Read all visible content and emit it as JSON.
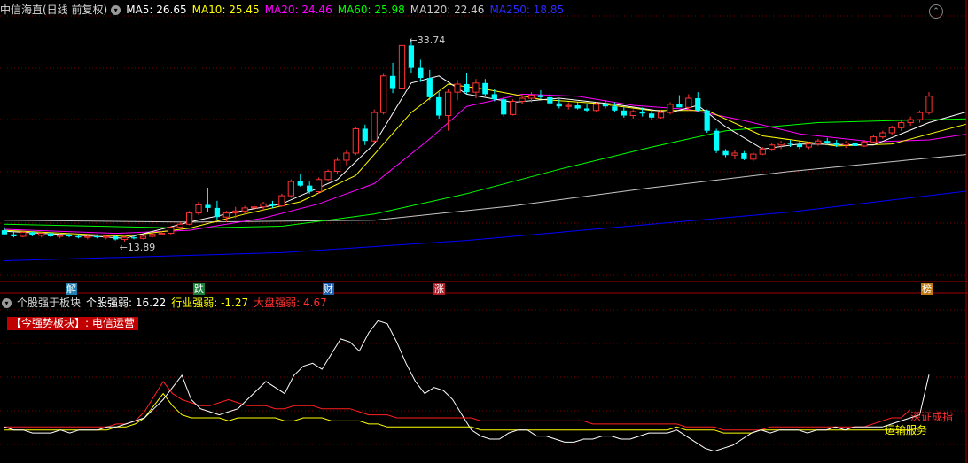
{
  "header": {
    "stock_title": "中信海直(日线 前复权)",
    "ma5": "MA5: 26.65",
    "ma10": "MA10: 25.45",
    "ma20": "MA20: 24.46",
    "ma60": "MA60: 25.98",
    "ma120": "MA120: 22.46",
    "ma250": "MA250: 18.85"
  },
  "sub_header": {
    "title": "个股强于板块",
    "stock_strength": "个股强弱: 16.22",
    "industry_strength": "行业强弱: -1.27",
    "market_strength": "大盘强弱: 4.67"
  },
  "sector_tag": "【今强势板块】: 电信运营",
  "right_labels": {
    "shenzhen": "深证成指",
    "transport": "运输服务"
  },
  "badges": [
    {
      "text": "解",
      "color": "#1e7fb0",
      "fg": "#fff"
    },
    {
      "text": "跌",
      "color": "#1b7f3a",
      "fg": "#fff"
    },
    {
      "text": "财",
      "color": "#1f5fb0",
      "fg": "#fff"
    },
    {
      "text": "涨",
      "color": "#b01e2a",
      "fg": "#fff"
    },
    {
      "text": "榜",
      "color": "#c07a10",
      "fg": "#fff"
    }
  ],
  "colors": {
    "ma5": "#ffffff",
    "ma10": "#ffff00",
    "ma20": "#ff00ff",
    "ma60": "#00ff00",
    "ma120": "#c8c8c8",
    "ma250": "#0000ff",
    "up": "#ff3232",
    "down": "#00ffff",
    "grid": "#7a0000"
  },
  "chart_data": [
    {
      "type": "candlestick",
      "title": "中信海直(日线 前复权)",
      "annotations": [
        {
          "text": "33.74",
          "note": "high"
        },
        {
          "text": "13.89",
          "note": "low"
        }
      ],
      "candles": [
        [
          15.0,
          15.3,
          14.6,
          14.6
        ],
        [
          14.6,
          14.8,
          14.3,
          14.4
        ],
        [
          14.4,
          14.9,
          14.3,
          14.8
        ],
        [
          14.8,
          14.9,
          14.4,
          14.5
        ],
        [
          14.5,
          14.8,
          14.3,
          14.7
        ],
        [
          14.7,
          14.8,
          14.3,
          14.4
        ],
        [
          14.4,
          14.6,
          14.2,
          14.5
        ],
        [
          14.5,
          14.7,
          14.3,
          14.4
        ],
        [
          14.4,
          14.6,
          14.2,
          14.3
        ],
        [
          14.3,
          14.5,
          14.1,
          14.4
        ],
        [
          14.4,
          14.6,
          14.2,
          14.3
        ],
        [
          14.3,
          14.5,
          14.1,
          14.4
        ],
        [
          14.4,
          14.5,
          14.0,
          14.1
        ],
        [
          14.1,
          14.4,
          13.89,
          14.3
        ],
        [
          14.3,
          14.5,
          14.1,
          14.2
        ],
        [
          14.2,
          14.5,
          14.1,
          14.4
        ],
        [
          14.4,
          14.7,
          14.3,
          14.6
        ],
        [
          14.6,
          14.9,
          14.5,
          14.7
        ],
        [
          14.7,
          15.4,
          14.6,
          15.3
        ],
        [
          15.3,
          15.8,
          15.1,
          15.6
        ],
        [
          15.6,
          16.9,
          15.5,
          16.7
        ],
        [
          16.7,
          17.8,
          16.5,
          17.5
        ],
        [
          17.5,
          19.2,
          16.8,
          17.2
        ],
        [
          17.2,
          17.9,
          16.0,
          16.3
        ],
        [
          16.3,
          16.9,
          15.8,
          16.7
        ],
        [
          16.7,
          17.3,
          16.2,
          16.9
        ],
        [
          16.9,
          17.4,
          16.6,
          17.2
        ],
        [
          17.2,
          17.6,
          16.9,
          17.3
        ],
        [
          17.3,
          17.8,
          17.0,
          17.6
        ],
        [
          17.6,
          17.9,
          17.2,
          17.4
        ],
        [
          17.4,
          18.6,
          17.3,
          18.4
        ],
        [
          18.4,
          20.0,
          18.2,
          19.8
        ],
        [
          19.8,
          20.6,
          19.3,
          19.4
        ],
        [
          19.4,
          19.8,
          18.6,
          18.8
        ],
        [
          18.8,
          20.2,
          18.6,
          20.0
        ],
        [
          20.0,
          21.0,
          19.8,
          20.8
        ],
        [
          20.8,
          22.2,
          20.6,
          21.9
        ],
        [
          21.9,
          22.9,
          21.4,
          22.6
        ],
        [
          22.6,
          25.2,
          22.4,
          25.0
        ],
        [
          25.0,
          25.4,
          23.4,
          23.8
        ],
        [
          23.8,
          26.9,
          23.6,
          26.6
        ],
        [
          26.6,
          30.4,
          26.4,
          30.2
        ],
        [
          30.2,
          31.5,
          28.5,
          29.0
        ],
        [
          29.0,
          33.74,
          28.6,
          33.2
        ],
        [
          33.2,
          33.74,
          30.5,
          31.0
        ],
        [
          31.0,
          31.8,
          29.6,
          30.0
        ],
        [
          30.0,
          30.8,
          27.8,
          28.1
        ],
        [
          28.1,
          28.6,
          26.0,
          26.3
        ],
        [
          26.3,
          28.9,
          24.8,
          28.6
        ],
        [
          28.6,
          29.8,
          27.8,
          29.4
        ],
        [
          29.4,
          30.5,
          28.4,
          28.6
        ],
        [
          28.6,
          29.9,
          28.0,
          29.5
        ],
        [
          29.5,
          29.9,
          28.2,
          28.4
        ],
        [
          28.4,
          28.9,
          27.7,
          27.9
        ],
        [
          27.9,
          28.1,
          26.2,
          26.4
        ],
        [
          26.4,
          27.9,
          26.3,
          27.7
        ],
        [
          27.7,
          28.4,
          27.4,
          28.0
        ],
        [
          28.0,
          28.6,
          27.6,
          28.3
        ],
        [
          28.3,
          28.8,
          27.9,
          28.1
        ],
        [
          28.1,
          28.5,
          27.3,
          27.5
        ],
        [
          27.5,
          27.9,
          27.0,
          27.2
        ],
        [
          27.2,
          27.6,
          26.9,
          27.3
        ],
        [
          27.3,
          27.6,
          26.9,
          27.0
        ],
        [
          27.0,
          27.4,
          26.6,
          26.8
        ],
        [
          26.8,
          27.6,
          26.7,
          27.4
        ],
        [
          27.4,
          27.8,
          27.0,
          27.2
        ],
        [
          27.2,
          27.6,
          26.6,
          26.8
        ],
        [
          26.8,
          27.1,
          26.1,
          26.3
        ],
        [
          26.3,
          26.9,
          26.0,
          26.7
        ],
        [
          26.7,
          27.1,
          26.2,
          26.5
        ],
        [
          26.5,
          26.9,
          25.9,
          26.1
        ],
        [
          26.1,
          26.8,
          26.0,
          26.6
        ],
        [
          26.6,
          27.6,
          26.4,
          27.4
        ],
        [
          27.4,
          28.3,
          27.1,
          27.1
        ],
        [
          27.1,
          28.4,
          26.8,
          28.0
        ],
        [
          28.0,
          28.6,
          26.7,
          26.8
        ],
        [
          26.8,
          26.9,
          24.6,
          24.8
        ],
        [
          24.8,
          25.0,
          22.6,
          22.8
        ],
        [
          22.8,
          23.0,
          22.2,
          22.4
        ],
        [
          22.4,
          22.9,
          22.0,
          22.6
        ],
        [
          22.6,
          22.8,
          21.9,
          22.0
        ],
        [
          22.0,
          22.7,
          21.8,
          22.5
        ],
        [
          22.5,
          23.2,
          22.4,
          23.0
        ],
        [
          23.0,
          23.6,
          22.8,
          23.4
        ],
        [
          23.4,
          23.8,
          23.0,
          23.6
        ],
        [
          23.6,
          23.9,
          23.2,
          23.5
        ],
        [
          23.5,
          23.8,
          23.0,
          23.2
        ],
        [
          23.2,
          23.7,
          23.0,
          23.5
        ],
        [
          23.5,
          24.0,
          23.3,
          23.8
        ],
        [
          23.8,
          24.1,
          23.4,
          23.6
        ],
        [
          23.6,
          23.9,
          23.2,
          23.4
        ],
        [
          23.4,
          23.8,
          23.1,
          23.6
        ],
        [
          23.6,
          23.9,
          23.2,
          23.3
        ],
        [
          23.3,
          23.9,
          23.2,
          23.7
        ],
        [
          23.7,
          24.4,
          23.6,
          24.2
        ],
        [
          24.2,
          24.8,
          24.0,
          24.6
        ],
        [
          24.6,
          25.3,
          24.4,
          25.1
        ],
        [
          25.1,
          25.8,
          24.8,
          25.6
        ],
        [
          25.6,
          26.2,
          25.3,
          25.9
        ],
        [
          25.9,
          26.8,
          25.6,
          26.6
        ],
        [
          26.6,
          28.6,
          26.4,
          28.2
        ]
      ],
      "ma": {
        "ma5": [
          [
            0,
            14.9
          ],
          [
            10,
            14.4
          ],
          [
            13,
            14.2
          ],
          [
            20,
            15.8
          ],
          [
            25,
            16.8
          ],
          [
            30,
            17.6
          ],
          [
            36,
            20.0
          ],
          [
            40,
            23.5
          ],
          [
            44,
            29.5
          ],
          [
            47,
            30.2
          ],
          [
            50,
            28.4
          ],
          [
            55,
            27.6
          ],
          [
            60,
            28.0
          ],
          [
            66,
            27.4
          ],
          [
            72,
            26.6
          ],
          [
            75,
            27.3
          ],
          [
            78,
            25.2
          ],
          [
            82,
            23.0
          ],
          [
            86,
            23.5
          ],
          [
            94,
            23.4
          ],
          [
            100,
            25.6
          ],
          [
            104,
            26.65
          ]
        ],
        "ma10": [
          [
            0,
            15.0
          ],
          [
            13,
            14.4
          ],
          [
            20,
            15.2
          ],
          [
            26,
            16.6
          ],
          [
            32,
            17.8
          ],
          [
            38,
            20.4
          ],
          [
            44,
            26.6
          ],
          [
            48,
            29.4
          ],
          [
            52,
            28.9
          ],
          [
            58,
            27.9
          ],
          [
            64,
            27.5
          ],
          [
            70,
            26.8
          ],
          [
            76,
            26.8
          ],
          [
            82,
            24.3
          ],
          [
            90,
            23.3
          ],
          [
            96,
            23.5
          ],
          [
            104,
            25.45
          ]
        ],
        "ma20": [
          [
            0,
            15.1
          ],
          [
            12,
            14.7
          ],
          [
            20,
            15.0
          ],
          [
            28,
            16.2
          ],
          [
            34,
            17.6
          ],
          [
            40,
            19.6
          ],
          [
            46,
            24.0
          ],
          [
            50,
            27.2
          ],
          [
            56,
            28.4
          ],
          [
            62,
            28.2
          ],
          [
            68,
            27.3
          ],
          [
            74,
            26.9
          ],
          [
            80,
            25.8
          ],
          [
            86,
            24.5
          ],
          [
            94,
            23.7
          ],
          [
            100,
            23.9
          ],
          [
            104,
            24.46
          ]
        ],
        "ma60": [
          [
            0,
            15.6
          ],
          [
            20,
            15.2
          ],
          [
            30,
            15.4
          ],
          [
            40,
            16.6
          ],
          [
            50,
            18.6
          ],
          [
            60,
            21.0
          ],
          [
            70,
            23.2
          ],
          [
            78,
            24.8
          ],
          [
            88,
            25.6
          ],
          [
            96,
            25.8
          ],
          [
            104,
            25.98
          ]
        ],
        "ma120": [
          [
            0,
            16.0
          ],
          [
            20,
            15.8
          ],
          [
            40,
            16.0
          ],
          [
            55,
            17.4
          ],
          [
            70,
            19.2
          ],
          [
            85,
            20.8
          ],
          [
            104,
            22.46
          ]
        ],
        "ma250": [
          [
            0,
            12.0
          ],
          [
            30,
            12.8
          ],
          [
            50,
            14.0
          ],
          [
            70,
            15.6
          ],
          [
            85,
            16.8
          ],
          [
            104,
            18.85
          ]
        ]
      }
    },
    {
      "type": "line",
      "title": "个股强于板块",
      "series": [
        {
          "name": "个股强弱",
          "color": "#ffffff",
          "values": [
            -1,
            -2,
            -2,
            -3,
            -3,
            -3,
            -2,
            -3,
            -2,
            -2,
            -2,
            -1,
            -1,
            0,
            1,
            2,
            5,
            8,
            12,
            16,
            8,
            5,
            4,
            3,
            4,
            5,
            8,
            11,
            14,
            12,
            10,
            16,
            19,
            20,
            18,
            23,
            28,
            27,
            24,
            30,
            34,
            33,
            27,
            20,
            14,
            10,
            12,
            11,
            8,
            3,
            -2,
            -4,
            -5,
            -5,
            -3,
            -2,
            -2,
            -4,
            -4,
            -5,
            -6,
            -6,
            -5,
            -5,
            -4,
            -4,
            -5,
            -5,
            -4,
            -3,
            -3,
            -3,
            -2,
            -4,
            -6,
            -8,
            -9,
            -8,
            -7,
            -5,
            -3,
            -2,
            -3,
            -2,
            -2,
            -2,
            -3,
            -2,
            -2,
            -1,
            -2,
            -1,
            -1,
            -1,
            -1,
            0,
            1,
            2,
            3,
            16.22
          ]
        },
        {
          "name": "行业强弱",
          "color": "#ffff00",
          "values": [
            -2,
            -2,
            -2,
            -2,
            -2,
            -2,
            -2,
            -2,
            -2,
            -2,
            -2,
            -2,
            -1,
            -1,
            0,
            2,
            6,
            10,
            6,
            3,
            2,
            2,
            2,
            2,
            1,
            2,
            2,
            2,
            2,
            2,
            1,
            1,
            2,
            2,
            2,
            1,
            1,
            1,
            1,
            0,
            0,
            -1,
            -1,
            -1,
            -1,
            -1,
            -1,
            -1,
            -1,
            -1,
            -1,
            -2,
            -2,
            -2,
            -2,
            -2,
            -2,
            -2,
            -2,
            -2,
            -2,
            -2,
            -2,
            -2,
            -2,
            -2,
            -2,
            -2,
            -2,
            -2,
            -2,
            -2,
            -1,
            -2,
            -2,
            -2,
            -2,
            -3,
            -3,
            -3,
            -3,
            -2,
            -2,
            -2,
            -2,
            -2,
            -2,
            -2,
            -2,
            -2,
            -2,
            -2,
            -2,
            -2,
            -2,
            -2,
            -2,
            -2,
            -1.27
          ]
        },
        {
          "name": "大盘强弱",
          "color": "#ff2020",
          "values": [
            -1,
            -1,
            -1,
            -1,
            -1,
            -1,
            -1,
            -1,
            -1,
            -1,
            -1,
            -1,
            0,
            0,
            1,
            4,
            9,
            14,
            10,
            8,
            7,
            6,
            6,
            7,
            8,
            7,
            6,
            6,
            6,
            5,
            5,
            6,
            6,
            6,
            5,
            5,
            5,
            5,
            4,
            3,
            3,
            3,
            2,
            2,
            2,
            2,
            2,
            2,
            2,
            2,
            2,
            1,
            1,
            1,
            1,
            1,
            1,
            1,
            1,
            1,
            1,
            1,
            1,
            0,
            0,
            0,
            0,
            0,
            0,
            0,
            0,
            0,
            0,
            -1,
            -1,
            -1,
            -1,
            -2,
            -2,
            -2,
            -2,
            -2,
            -1,
            -1,
            -1,
            -1,
            -1,
            -1,
            -1,
            -1,
            -1,
            -1,
            -1,
            0,
            1,
            2,
            2,
            4.67
          ]
        }
      ]
    }
  ]
}
